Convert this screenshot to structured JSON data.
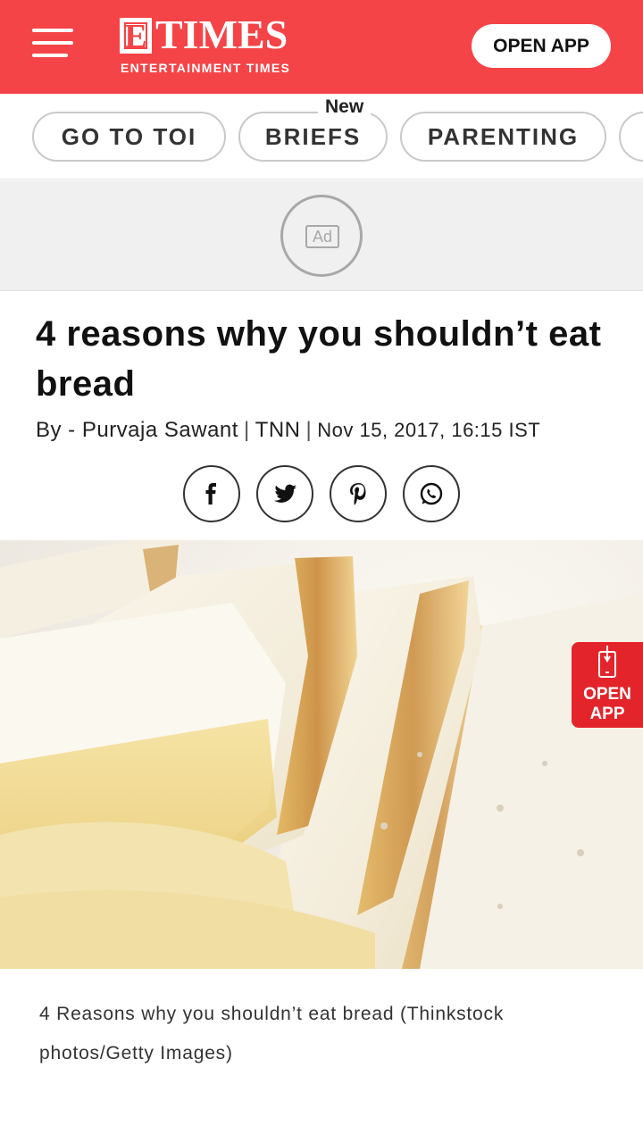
{
  "header": {
    "logo_letter": "E",
    "logo_text": "TIMES",
    "logo_subtitle": "ENTERTAINMENT TIMES",
    "open_app_label": "OPEN APP",
    "menu_icon": "hamburger-menu-icon"
  },
  "nav": {
    "new_tag": "New",
    "pills": [
      {
        "label": "GO TO TOI"
      },
      {
        "label": "BRIEFS"
      },
      {
        "label": "PARENTING"
      },
      {
        "label": ""
      }
    ]
  },
  "ad": {
    "label": "Ad"
  },
  "article": {
    "headline": "4 reasons why you shouldn’t eat bread",
    "byline_author": "By - Purvaja Sawant",
    "byline_source": "TNN",
    "byline_date": "Nov 15, 2017, 16:15 IST",
    "share_icons": [
      "facebook-icon",
      "twitter-icon",
      "pinterest-icon",
      "whatsapp-icon"
    ],
    "caption": "4 Reasons why you shouldn’t eat bread (Thinkstock photos/Getty Images)"
  },
  "floating_app": {
    "label_line1": "OPEN",
    "label_line2": "APP"
  },
  "colors": {
    "brand_red": "#f54448",
    "float_red": "#e3242b"
  }
}
